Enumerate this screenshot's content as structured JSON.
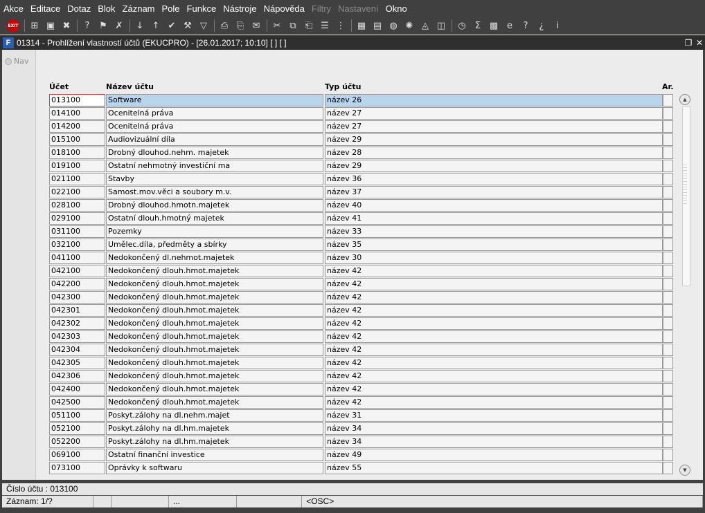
{
  "menu": [
    {
      "label": "Akce",
      "enabled": true
    },
    {
      "label": "Editace",
      "enabled": true
    },
    {
      "label": "Dotaz",
      "enabled": true
    },
    {
      "label": "Blok",
      "enabled": true
    },
    {
      "label": "Záznam",
      "enabled": true
    },
    {
      "label": "Pole",
      "enabled": true
    },
    {
      "label": "Funkce",
      "enabled": true
    },
    {
      "label": "Nástroje",
      "enabled": true
    },
    {
      "label": "Nápověda",
      "enabled": true
    },
    {
      "label": "Filtry",
      "enabled": false
    },
    {
      "label": "Nastavení",
      "enabled": false
    },
    {
      "label": "Okno",
      "enabled": true
    }
  ],
  "toolbar": {
    "exit_label": "EXIT",
    "icons": [
      "insert-record-icon",
      "save-icon",
      "delete-record-icon",
      "query-icon",
      "execute-query-icon",
      "cancel-query-icon",
      "sort-asc-icon",
      "sort-desc-icon",
      "confirm-icon",
      "tools-icon",
      "filter-icon",
      "print-icon",
      "print-preview-icon",
      "mail-icon",
      "cut-icon",
      "copy-icon",
      "paste-icon",
      "list-icon",
      "tree-icon",
      "calculator-icon",
      "document-icon",
      "globe-icon",
      "settings-icon",
      "chart-icon",
      "graph-icon",
      "clock-icon",
      "sum-icon",
      "excel-icon",
      "ie-icon",
      "help-icon",
      "help-context-icon",
      "info-icon"
    ]
  },
  "window": {
    "title": "01314 - Prohlížení vlastností účtů (EKUCPRO) - [26.01.2017; 10:10]  [ ] [ ]",
    "app_icon": "app-logo-icon"
  },
  "nav": {
    "label": "Nav"
  },
  "table": {
    "headers": {
      "account": "Účet",
      "name": "Název účtu",
      "type": "Typ účtu",
      "ar": "Ar."
    },
    "rows": [
      {
        "account": "013100",
        "name": "Software",
        "type": "název 26"
      },
      {
        "account": "014100",
        "name": "Ocenitelná práva",
        "type": "název 27"
      },
      {
        "account": "014200",
        "name": "Ocenitelná práva",
        "type": "název 27"
      },
      {
        "account": "015100",
        "name": "Audiovizuální díla",
        "type": "název 29"
      },
      {
        "account": "018100",
        "name": "Drobný dlouhod.nehm. majetek",
        "type": "název 28"
      },
      {
        "account": "019100",
        "name": "Ostatní nehmotný investiční ma",
        "type": "název 29"
      },
      {
        "account": "021100",
        "name": "Stavby",
        "type": "název 36"
      },
      {
        "account": "022100",
        "name": "Samost.mov.věci a soubory m.v.",
        "type": "název 37"
      },
      {
        "account": "028100",
        "name": "Drobný dlouhod.hmotn.majetek",
        "type": "název 40"
      },
      {
        "account": "029100",
        "name": "Ostatní dlouh.hmotný majetek",
        "type": "název 41"
      },
      {
        "account": "031100",
        "name": "Pozemky",
        "type": "název 33"
      },
      {
        "account": "032100",
        "name": "Umělec.díla, předměty a sbírky",
        "type": "název 35"
      },
      {
        "account": "041100",
        "name": "Nedokončený dl.nehmot.majetek",
        "type": "název 30"
      },
      {
        "account": "042100",
        "name": "Nedokončený dlouh.hmot.majetek",
        "type": "název 42"
      },
      {
        "account": "042200",
        "name": "Nedokončený dlouh.hmot.majetek",
        "type": "název 42"
      },
      {
        "account": "042300",
        "name": "Nedokončený dlouh.hmot.majetek",
        "type": "název 42"
      },
      {
        "account": "042301",
        "name": "Nedokončený dlouh.hmot.majetek",
        "type": "název 42"
      },
      {
        "account": "042302",
        "name": "Nedokončený dlouh.hmot.majetek",
        "type": "název 42"
      },
      {
        "account": "042303",
        "name": "Nedokončený dlouh.hmot.majetek",
        "type": "název 42"
      },
      {
        "account": "042304",
        "name": "Nedokončený dlouh.hmot.majetek",
        "type": "název 42"
      },
      {
        "account": "042305",
        "name": "Nedokončený dlouh.hmot.majetek",
        "type": "název 42"
      },
      {
        "account": "042306",
        "name": "Nedokončený dlouh.hmot.majetek",
        "type": "název 42"
      },
      {
        "account": "042400",
        "name": "Nedokončený dlouh.hmot.majetek",
        "type": "název 42"
      },
      {
        "account": "042500",
        "name": "Nedokončený dlouh.hmot.majetek",
        "type": "název 42"
      },
      {
        "account": "051100",
        "name": "Poskyt.zálohy na dl.nehm.majet",
        "type": "název 31"
      },
      {
        "account": "052100",
        "name": "Poskyt.zálohy na dl.hm.majetek",
        "type": "název 34"
      },
      {
        "account": "052200",
        "name": "Poskyt.zálohy na dl.hm.majetek",
        "type": "název 34"
      },
      {
        "account": "069100",
        "name": "Ostatní finanční investice",
        "type": "název 49"
      },
      {
        "account": "073100",
        "name": "Oprávky k softwaru",
        "type": "název 55"
      }
    ],
    "selected_index": 0
  },
  "status": {
    "line1": "Číslo účtu : 013100",
    "segments": [
      "Záznam: 1/?",
      "",
      "",
      "...",
      "",
      "<OSC>"
    ]
  },
  "colors": {
    "chrome": "#404040",
    "selection": "#b9d5ee",
    "focus_border": "#d04040"
  }
}
